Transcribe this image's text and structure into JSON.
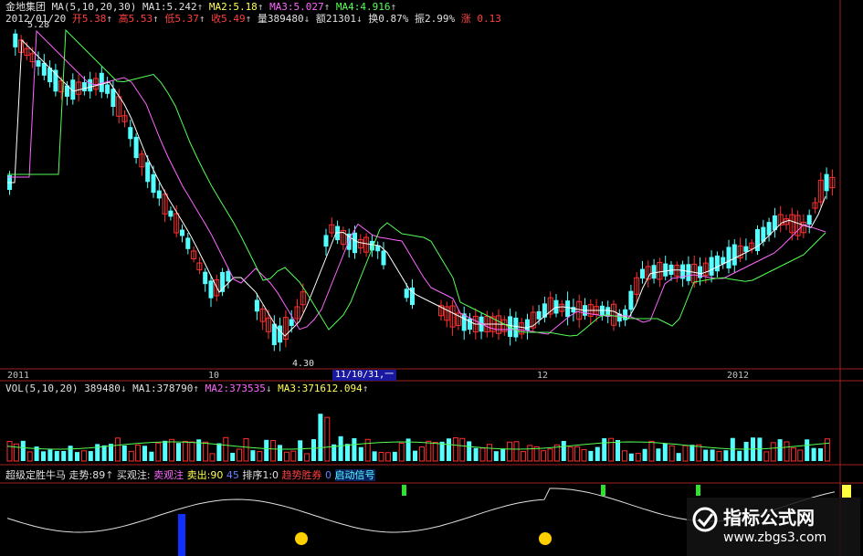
{
  "stock": {
    "name": "金地集团",
    "ma_params": "MA(5,10,20,30)",
    "ma1": "MA1:5.242",
    "ma2": "MA2:5.18",
    "ma3": "MA3:5.027",
    "ma4": "MA4:4.916",
    "date": "2012/01/20",
    "open": "开5.38",
    "high": "高5.53",
    "low": "低5.37",
    "close": "收5.49",
    "volume": "量389480",
    "amount": "额21301",
    "turnover": "换0.87%",
    "amplitude": "振2.99%",
    "change": "涨 0.13",
    "max_price": "5.28",
    "min_price": "4.30"
  },
  "axis": {
    "labels": [
      "2011",
      "10",
      "12",
      "2012"
    ],
    "selected": "11/10/31,一"
  },
  "volume": {
    "params": "VOL(5,10,20)",
    "value": "389480",
    "ma1": "MA1:378790",
    "ma2": "MA2:373535",
    "ma3": "MA3:371612.094"
  },
  "indicator": {
    "name": "超级定胜牛马",
    "trend": "走势:89",
    "buy_watch": "买观注:",
    "sell_watch": "卖观注",
    "sell_out": "卖出:90",
    "level": "45",
    "rank": "排序1:0",
    "bull_trend": "趋势胜券",
    "zero": "0",
    "start": "启动信号"
  },
  "watermark": {
    "title": "指标公式网",
    "url": "www.zbgs3.com"
  },
  "colors": {
    "up": "#ff3030",
    "down": "#55ffff",
    "ma1": "#ffffff",
    "ma2": "#ff66ff",
    "ma3": "#55ff55",
    "ma4": "#ffff55"
  }
}
